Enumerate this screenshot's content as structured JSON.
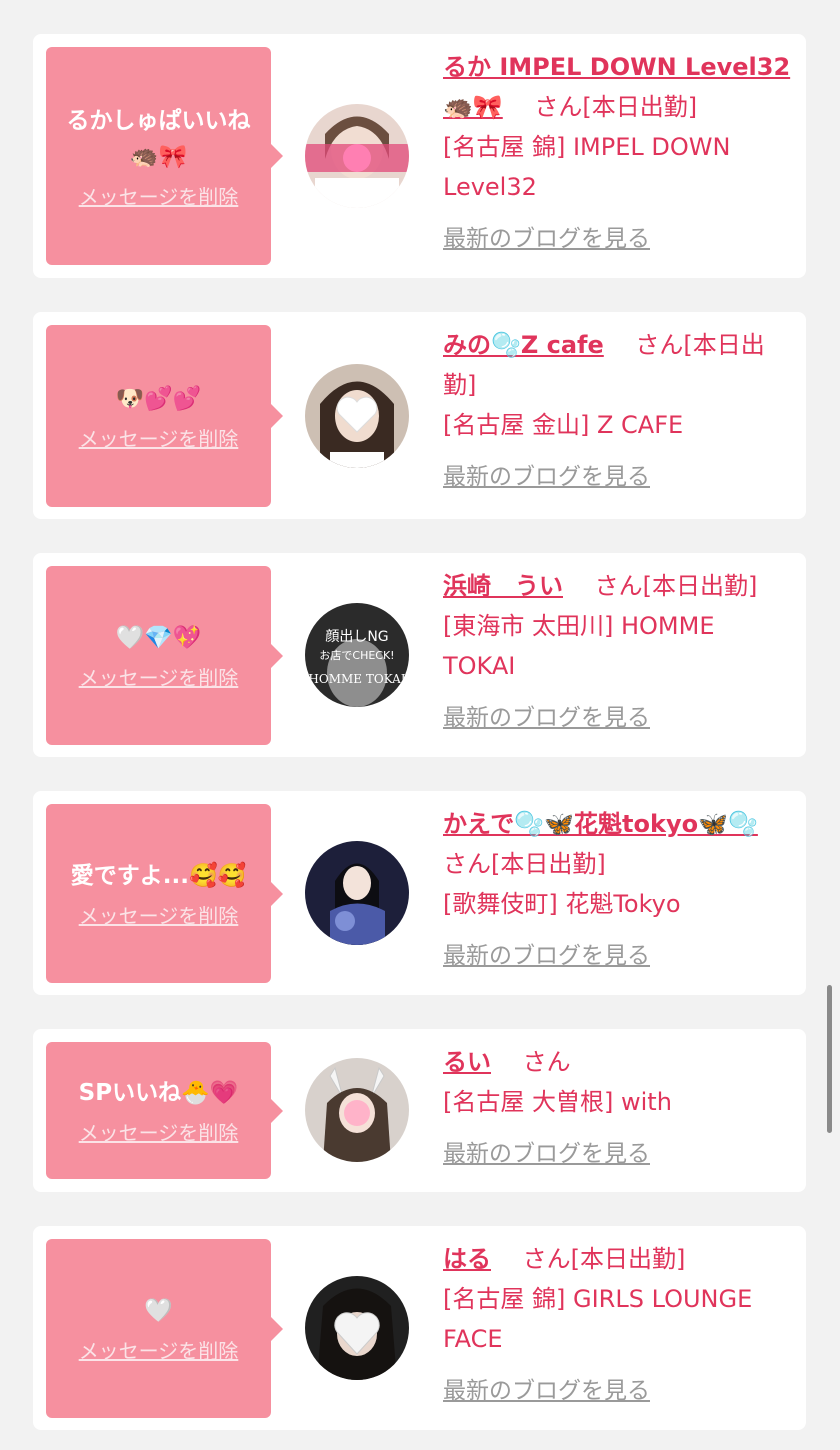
{
  "colors": {
    "accent": "#e0345b",
    "message_bg": "#f6909f",
    "page_bg": "#f2f2f2",
    "muted": "#9a9a9a"
  },
  "cards": [
    {
      "message": "るかしゅぱいいね\n🦔🎀",
      "delete_label": "メッセージを削除",
      "cast_name": "るか IMPEL DOWN Level32🦔🎀",
      "honorific": "さん",
      "status": "[本日出勤]",
      "shop": "[名古屋 錦] IMPEL DOWN Level32",
      "blog_label": "最新のブログを見る"
    },
    {
      "message": "🐶💕💕",
      "delete_label": "メッセージを削除",
      "cast_name": "みの🫧Z cafe",
      "honorific": "さん",
      "status": "[本日出勤]",
      "shop": "[名古屋 金山] Z CAFE",
      "blog_label": "最新のブログを見る"
    },
    {
      "message": "🤍💎💖",
      "delete_label": "メッセージを削除",
      "cast_name": "浜崎　うい",
      "honorific": "さん",
      "status": "[本日出勤]",
      "shop": "[東海市 太田川] HOMME TOKAI",
      "blog_label": "最新のブログを見る"
    },
    {
      "message": "愛ですよ...🥰🥰",
      "delete_label": "メッセージを削除",
      "cast_name": "かえで🫧🦋花魁tokyo🦋🫧",
      "honorific": "さん",
      "status": "[本日出勤]",
      "shop": "[歌舞伎町] 花魁Tokyo",
      "blog_label": "最新のブログを見る"
    },
    {
      "message": "SPいいね🐣💗",
      "delete_label": "メッセージを削除",
      "cast_name": "るい",
      "honorific": "さん",
      "status": "",
      "shop": "[名古屋 大曽根] with",
      "blog_label": "最新のブログを見る"
    },
    {
      "message": "🤍",
      "delete_label": "メッセージを削除",
      "cast_name": "はる",
      "honorific": "さん",
      "status": "[本日出勤]",
      "shop": "[名古屋 錦] GIRLS LOUNGE FACE",
      "blog_label": "最新のブログを見る"
    }
  ],
  "avatar_overlays": [
    "lips-sticker",
    "heart-sticker",
    "顔出しNG\nお店でCHECK!\nHOMME TOKAI",
    "",
    "heart-sticker",
    "heart-sticker"
  ]
}
